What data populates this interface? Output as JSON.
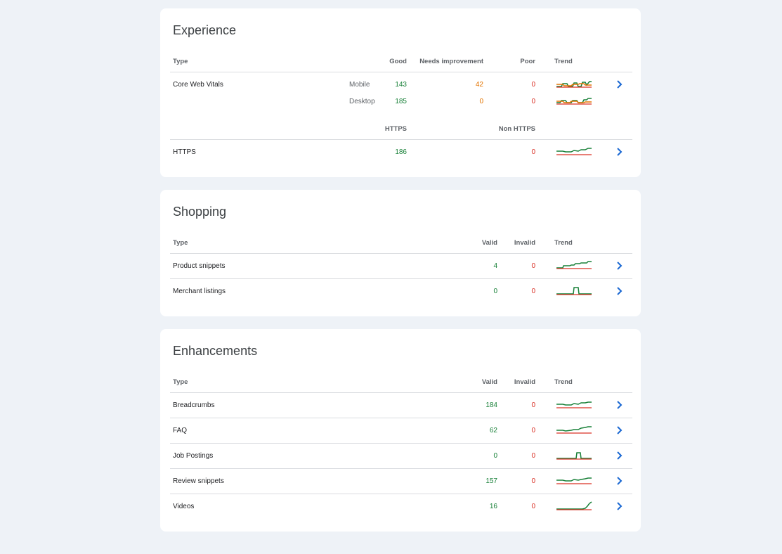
{
  "colors": {
    "good": "#188038",
    "needs_improvement": "#e37400",
    "poor": "#d93025",
    "accent": "#1a73e8"
  },
  "experience": {
    "title": "Experience",
    "headers": {
      "type": "Type",
      "good": "Good",
      "needs_improvement": "Needs improvement",
      "poor": "Poor",
      "trend": "Trend"
    },
    "core_web_vitals": {
      "name": "Core Web Vitals",
      "mobile": {
        "label": "Mobile",
        "good": "143",
        "needs_improvement": "42",
        "poor": "0"
      },
      "desktop": {
        "label": "Desktop",
        "good": "185",
        "needs_improvement": "0",
        "poor": "0"
      }
    },
    "https_headers": {
      "https": "HTTPS",
      "non_https": "Non HTTPS"
    },
    "https_row": {
      "name": "HTTPS",
      "https": "186",
      "non_https": "0"
    }
  },
  "shopping": {
    "title": "Shopping",
    "headers": {
      "type": "Type",
      "valid": "Valid",
      "invalid": "Invalid",
      "trend": "Trend"
    },
    "rows": [
      {
        "name": "Product snippets",
        "valid": "4",
        "invalid": "0"
      },
      {
        "name": "Merchant listings",
        "valid": "0",
        "invalid": "0"
      }
    ]
  },
  "enhancements": {
    "title": "Enhancements",
    "headers": {
      "type": "Type",
      "valid": "Valid",
      "invalid": "Invalid",
      "trend": "Trend"
    },
    "rows": [
      {
        "name": "Breadcrumbs",
        "valid": "184",
        "invalid": "0"
      },
      {
        "name": "FAQ",
        "valid": "62",
        "invalid": "0"
      },
      {
        "name": "Job Postings",
        "valid": "0",
        "invalid": "0"
      },
      {
        "name": "Review snippets",
        "valid": "157",
        "invalid": "0"
      },
      {
        "name": "Videos",
        "valid": "16",
        "invalid": "0"
      }
    ]
  }
}
